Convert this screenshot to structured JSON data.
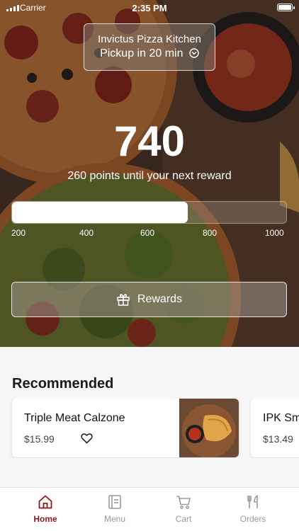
{
  "status_bar": {
    "carrier": "Carrier",
    "time": "2:35 PM"
  },
  "location": {
    "name": "Invictus Pizza Kitchen",
    "pickup": "Pickup in 20 min"
  },
  "loyalty": {
    "points": "740",
    "caption": "260 points until your next reward",
    "progress_fraction": 0.64,
    "ticks": [
      "200",
      "400",
      "600",
      "800",
      "1000"
    ],
    "rewards_label": "Rewards"
  },
  "recommended": {
    "title": "Recommended",
    "items": [
      {
        "name": "Triple Meat Calzone",
        "price": "$15.99"
      },
      {
        "name": "IPK Sm",
        "price": "$13.49"
      }
    ]
  },
  "tabs": [
    {
      "label": "Home",
      "icon": "home-icon"
    },
    {
      "label": "Menu",
      "icon": "menu-icon"
    },
    {
      "label": "Cart",
      "icon": "cart-icon"
    },
    {
      "label": "Orders",
      "icon": "fork-knife-icon"
    }
  ],
  "colors": {
    "accent": "#8b1a1a",
    "tab_inactive": "#9a9a9a"
  }
}
